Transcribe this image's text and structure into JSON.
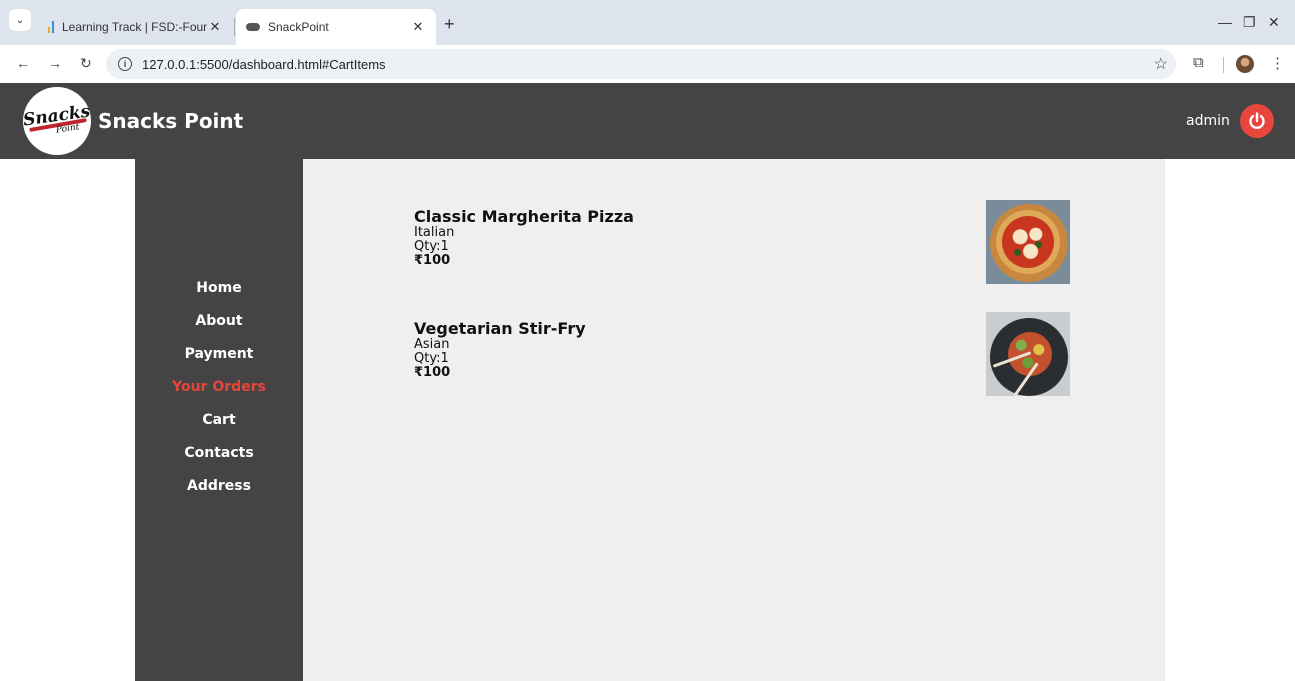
{
  "browser": {
    "tabs": [
      {
        "title": "Learning Track | FSD:-Foundatio",
        "active": false
      },
      {
        "title": "SnackPoint",
        "active": true
      }
    ],
    "url": "127.0.0.1:5500/dashboard.html#CartItems",
    "icons": {
      "tab_list": "chevron-down-icon",
      "close": "close-icon",
      "new_tab": "plus-icon",
      "back": "arrow-left-icon",
      "forward": "arrow-right-icon",
      "reload": "reload-icon",
      "site_info": "info-icon",
      "bookmark": "star-icon",
      "extensions": "puzzle-icon",
      "menu": "kebab-menu-icon"
    },
    "glyphs": {
      "chevron": "⌄",
      "close": "✕",
      "plus": "+",
      "back": "←",
      "forward": "→",
      "reload": "↻",
      "info": "i",
      "star": "☆",
      "puzzle": "⧉",
      "menu": "⋮",
      "minimize": "—",
      "restore": "❐",
      "win_close": "✕"
    }
  },
  "header": {
    "logo_text": "Snacks",
    "logo_subtext": "Point",
    "title": "Snacks Point",
    "username": "admin",
    "accent_color": "#e8453c",
    "background_color": "#444444"
  },
  "sidebar": {
    "items": [
      {
        "label": "Home",
        "active": false
      },
      {
        "label": "About",
        "active": false
      },
      {
        "label": "Payment",
        "active": false
      },
      {
        "label": "Your Orders",
        "active": true
      },
      {
        "label": "Cart",
        "active": false
      },
      {
        "label": "Contacts",
        "active": false
      },
      {
        "label": "Address",
        "active": false
      }
    ]
  },
  "cart": {
    "items": [
      {
        "name": "Classic Margherita Pizza",
        "cuisine": "Italian",
        "qty": "Qty:1",
        "price": "₹100",
        "image_icon": "pizza-image"
      },
      {
        "name": "Vegetarian Stir-Fry",
        "cuisine": "Asian",
        "qty": "Qty:1",
        "price": "₹100",
        "image_icon": "stir-fry-image"
      }
    ]
  }
}
